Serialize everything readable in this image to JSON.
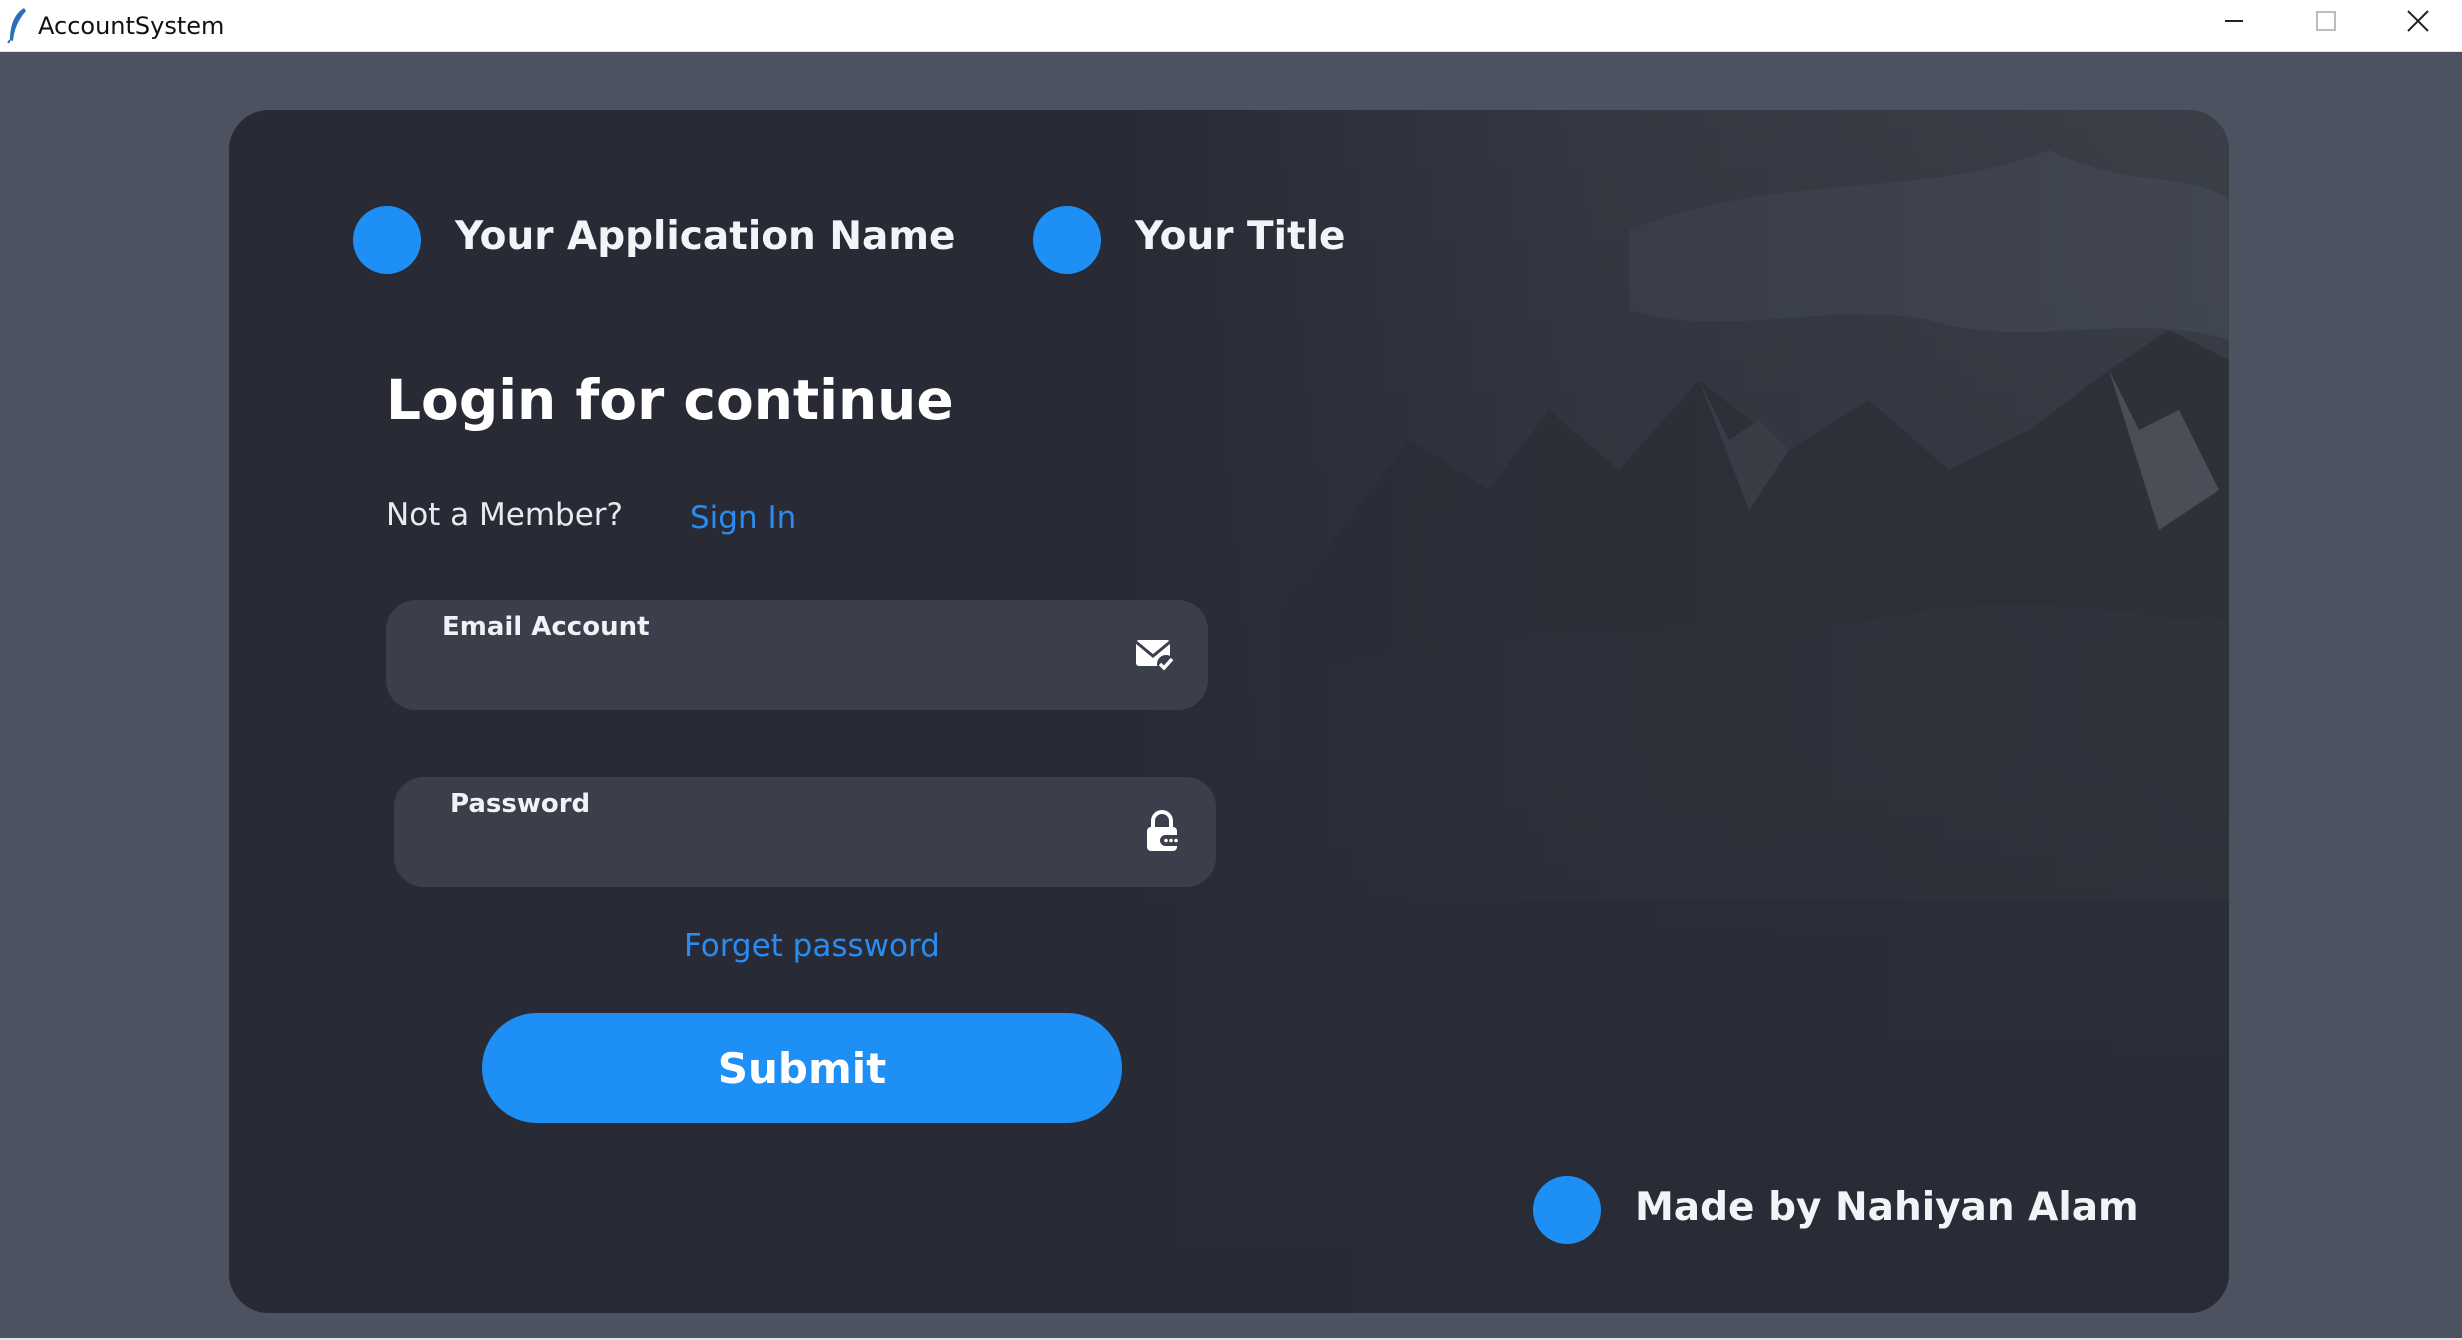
{
  "window": {
    "title": "AccountSystem",
    "controls": [
      "minimize",
      "maximize",
      "close"
    ]
  },
  "header": {
    "app_name": "Your Application Name",
    "title": "Your Title"
  },
  "login": {
    "heading": "Login for continue",
    "not_member": "Not a Member?",
    "sign_in": "Sign In",
    "email_label": "Email Account",
    "email_value": "",
    "email_icon": "mail-check-icon",
    "password_label": "Password",
    "password_value": "",
    "password_icon": "lock-icon",
    "forget": "Forget password",
    "submit": "Submit"
  },
  "footer": {
    "credit": "Made by Nahiyan Alam"
  },
  "colors": {
    "background": "#4d5261",
    "card": "#282b36",
    "field": "#3b3f4c",
    "accent": "#1e90f5",
    "link": "#2a8bf0",
    "text": "#ffffff"
  }
}
